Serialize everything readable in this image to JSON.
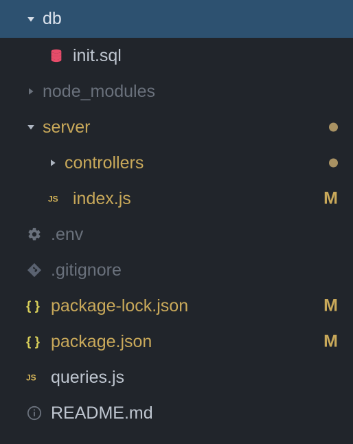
{
  "tree": {
    "items": [
      {
        "type": "folder",
        "name": "db",
        "expanded": true,
        "selected": true,
        "indent": 0,
        "color": "white",
        "chevronColor": "#d7dee8",
        "status": null
      },
      {
        "type": "file",
        "name": "init.sql",
        "icon": "database",
        "indent": 1,
        "color": "fg",
        "status": null
      },
      {
        "type": "folder",
        "name": "node_modules",
        "expanded": false,
        "indent": 0,
        "color": "dim",
        "chevronColor": "#6a717c",
        "status": null
      },
      {
        "type": "folder",
        "name": "server",
        "expanded": true,
        "indent": 0,
        "color": "amber",
        "chevronColor": "#aeb6c1",
        "status": "dot"
      },
      {
        "type": "folder",
        "name": "controllers",
        "expanded": false,
        "indent": 1,
        "color": "amber",
        "chevronColor": "#aeb6c1",
        "status": "dot"
      },
      {
        "type": "file",
        "name": "index.js",
        "icon": "js",
        "indent": 1,
        "color": "amber",
        "status": "M"
      },
      {
        "type": "file",
        "name": ".env",
        "icon": "gear",
        "indent": 0,
        "color": "dimgit",
        "status": null
      },
      {
        "type": "file",
        "name": ".gitignore",
        "icon": "git",
        "indent": 0,
        "color": "dimgit",
        "status": null
      },
      {
        "type": "file",
        "name": "package-lock.json",
        "icon": "json",
        "indent": 0,
        "color": "amber",
        "status": "M"
      },
      {
        "type": "file",
        "name": "package.json",
        "icon": "json",
        "indent": 0,
        "color": "amber",
        "status": "M"
      },
      {
        "type": "file",
        "name": "queries.js",
        "icon": "js",
        "indent": 0,
        "color": "fg",
        "status": null
      },
      {
        "type": "file",
        "name": "README.md",
        "icon": "info",
        "indent": 0,
        "color": "fg",
        "status": null
      }
    ]
  },
  "colors": {
    "database": "#e74c6a",
    "js": "#d9b85a",
    "json": "#d9d05a",
    "gear": "#6a717c",
    "git": "#5a6270",
    "info": "#6a717c"
  }
}
